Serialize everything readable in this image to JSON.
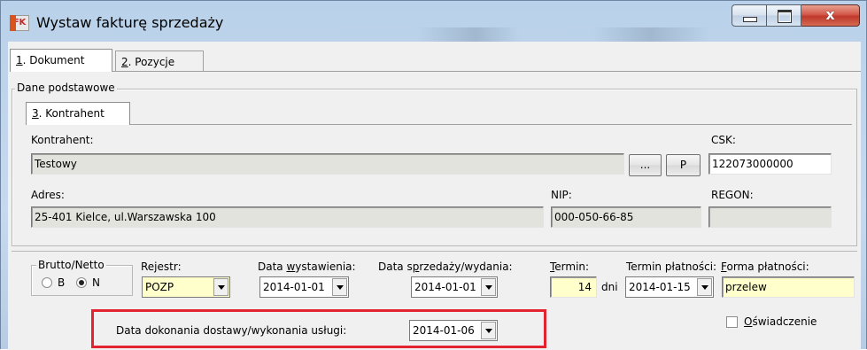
{
  "window": {
    "title": "Wystaw fakturę sprzedaży",
    "app_icon_text": "FK",
    "controls": {
      "minimize": "minimize",
      "maximize": "maximize",
      "close": "x"
    }
  },
  "tabs": [
    {
      "hotkey": "1",
      "label": ". Dokument",
      "active": true
    },
    {
      "hotkey": "2",
      "label": ". Pozycje",
      "active": false
    }
  ],
  "basic_group": {
    "label": "Dane podstawowe",
    "subtab": {
      "hotkey": "3",
      "label": ". Kontrahent"
    },
    "contractor_label": "Kontrahent:",
    "contractor_value": "Testowy",
    "browse_button": "...",
    "p_button": "P",
    "csk_label": "CSK:",
    "csk_value": "122073000000",
    "address_label": "Adres:",
    "address_value": "25-401 Kielce, ul.Warszawska 100",
    "nip_label": "NIP:",
    "nip_value": "000-050-66-85",
    "regon_label": "REGON:",
    "regon_value": ""
  },
  "brutto_netto": {
    "label": "Brutto/Netto",
    "options": [
      {
        "label": "B",
        "selected": false
      },
      {
        "label": "N",
        "selected": true
      }
    ]
  },
  "rejestr": {
    "label": "Rejestr:",
    "value": "POZP"
  },
  "data_wystawienia": {
    "label_pre": "Data ",
    "label_hotkey": "w",
    "label_post": "ystawienia:",
    "value": "2014-01-01"
  },
  "data_sprzedazy": {
    "label_pre": "Data s",
    "label_hotkey": "p",
    "label_post": "rzedaży/wydania:",
    "value": "2014-01-01"
  },
  "termin": {
    "label_hotkey": "T",
    "label_post": "ermin:",
    "value": "14",
    "unit": "dni"
  },
  "termin_platnosci": {
    "label": "Termin płatności:",
    "value": "2014-01-15"
  },
  "forma_platnosci": {
    "label_hotkey": "F",
    "label_post": "orma płatności:",
    "value": "przelew"
  },
  "data_dokonania": {
    "label": "Data dokonania dostawy/wykonania usługi:",
    "value": "2014-01-06"
  },
  "oswiadczenie": {
    "label_hotkey": "O",
    "label_post": "świadczenie",
    "checked": false
  },
  "colors": {
    "highlight": "#e3232f",
    "yellow_field": "#ffffcc",
    "disabled_field": "#e3e3de"
  }
}
